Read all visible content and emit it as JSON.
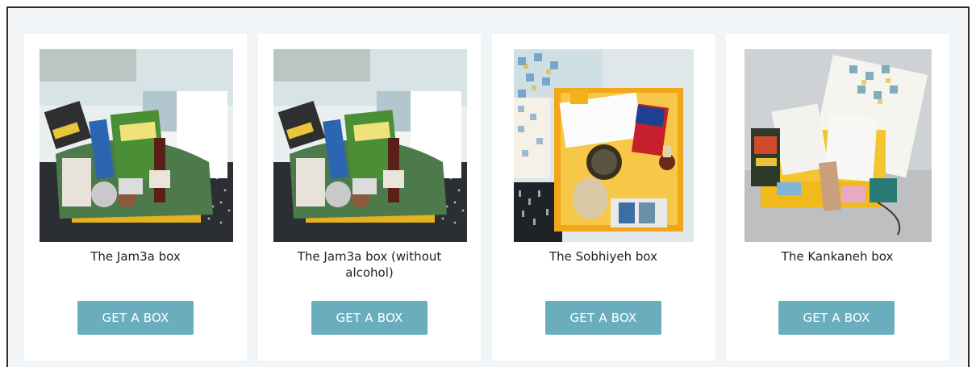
{
  "products": [
    {
      "title": "The Jam3a box",
      "button_label": "GET A BOX",
      "image_alt": "Jam3a box photo"
    },
    {
      "title": "The Jam3a box (without alcohol)",
      "button_label": "GET A BOX",
      "image_alt": "Jam3a box without alcohol photo"
    },
    {
      "title": "The Sobhiyeh box",
      "button_label": "GET A BOX",
      "image_alt": "Sobhiyeh box photo"
    },
    {
      "title": "The Kankaneh box",
      "button_label": "GET A BOX",
      "image_alt": "Kankaneh box photo"
    }
  ],
  "colors": {
    "page_background": "#f1f5f7",
    "card_background": "#ffffff",
    "button_background": "#6aaebd",
    "button_text": "#ffffff",
    "title_text": "#222222"
  }
}
